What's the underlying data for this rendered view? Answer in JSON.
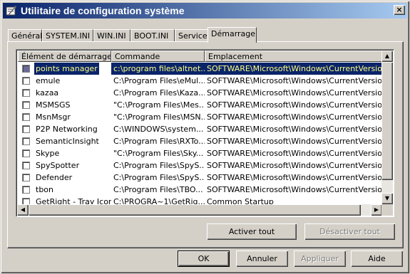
{
  "window": {
    "title": "Utilitaire de configuration système",
    "close_label": "×"
  },
  "tabs": [
    {
      "label": "Général"
    },
    {
      "label": "SYSTEM.INI"
    },
    {
      "label": "WIN.INI"
    },
    {
      "label": "BOOT.INI"
    },
    {
      "label": "Services"
    },
    {
      "label": "Démarrage"
    }
  ],
  "active_tab": "Démarrage",
  "list": {
    "columns": [
      "Élément de démarrage",
      "Commande",
      "Emplacement"
    ],
    "rows": [
      {
        "item": "points manager",
        "command": "c:\\program files\\altnet...",
        "location": "SOFTWARE\\Microsoft\\Windows\\CurrentVersion\\Ru",
        "selected": true
      },
      {
        "item": "emule",
        "command": "C:\\Program Files\\eMul...",
        "location": "SOFTWARE\\Microsoft\\Windows\\CurrentVersion\\Ru"
      },
      {
        "item": "kazaa",
        "command": "C:\\Program Files\\Kaza...",
        "location": "SOFTWARE\\Microsoft\\Windows\\CurrentVersion\\Ru"
      },
      {
        "item": "MSMSGS",
        "command": "\"C:\\Program Files\\Mes...",
        "location": "SOFTWARE\\Microsoft\\Windows\\CurrentVersion\\Ru"
      },
      {
        "item": "MsnMsgr",
        "command": "\"C:\\Program Files\\MSN...",
        "location": "SOFTWARE\\Microsoft\\Windows\\CurrentVersion\\Ru"
      },
      {
        "item": "P2P Networking",
        "command": "C:\\WINDOWS\\system...",
        "location": "SOFTWARE\\Microsoft\\Windows\\CurrentVersion\\Ru"
      },
      {
        "item": "SemanticInsight",
        "command": "C:\\Program Files\\RXTo...",
        "location": "SOFTWARE\\Microsoft\\Windows\\CurrentVersion\\Ru"
      },
      {
        "item": "Skype",
        "command": "\"C:\\Program Files\\Sky...",
        "location": "SOFTWARE\\Microsoft\\Windows\\CurrentVersion\\Ru"
      },
      {
        "item": "SpySpotter",
        "command": "C:\\Program Files\\SpyS...",
        "location": "SOFTWARE\\Microsoft\\Windows\\CurrentVersion\\Ru"
      },
      {
        "item": "Defender",
        "command": "C:\\Program Files\\SpyS...",
        "location": "SOFTWARE\\Microsoft\\Windows\\CurrentVersion\\Ru"
      },
      {
        "item": "tbon",
        "command": "C:\\Program Files\\TBO...",
        "location": "SOFTWARE\\Microsoft\\Windows\\CurrentVersion\\Ru"
      },
      {
        "item": "GetRight - Tray Icon",
        "command": "C:\\PROGRA~1\\GetRig...",
        "location": "Common Startup"
      }
    ]
  },
  "buttons": {
    "enable_all": "Activer tout",
    "disable_all": "Désactiver tout",
    "ok": "OK",
    "cancel": "Annuler",
    "apply": "Appliquer",
    "help": "Aide"
  },
  "colors": {
    "selection": "#0a246a",
    "selection_text": "#ffff80",
    "title_start": "#0a246a",
    "title_end": "#a6caf0"
  },
  "icons": [
    "msconfig-icon",
    "close-icon",
    "scroll-up-icon",
    "scroll-down-icon",
    "scroll-left-icon",
    "scroll-right-icon"
  ]
}
